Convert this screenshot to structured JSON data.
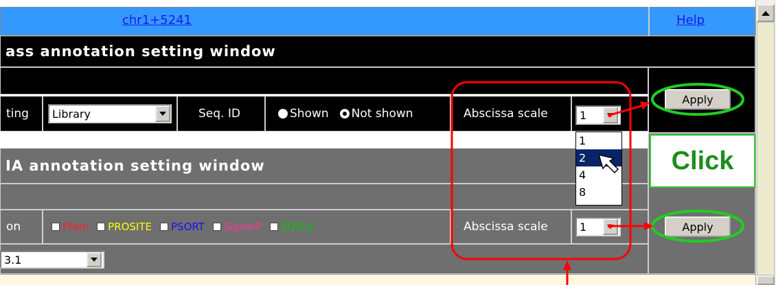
{
  "header": {
    "position_link": "chr1+5241",
    "help_link": "Help"
  },
  "section1": {
    "title": "ass annotation setting window",
    "setting_label": "ting",
    "library_select": "Library",
    "seq_id_label": "Seq. ID",
    "radio_shown": "Shown",
    "radio_not_shown": "Not shown",
    "abscissa_label": "Abscissa scale",
    "abscissa_value": "1",
    "apply_label": "Apply",
    "dropdown_options": [
      "1",
      "2",
      "4",
      "8"
    ],
    "dropdown_highlighted": "2"
  },
  "section2": {
    "title": "IA annotation setting window",
    "annotation_label": "on",
    "checkboxes": [
      {
        "label": "Pfam",
        "color": "#ff2020"
      },
      {
        "label": "PROSITE",
        "color": "#ffff00"
      },
      {
        "label": "PSORT",
        "color": "#1010ff"
      },
      {
        "label": "SignalP",
        "color": "#ff3399"
      },
      {
        "label": "SOSUI",
        "color": "#00cc00"
      }
    ],
    "abscissa_label": "Abscissa scale",
    "abscissa_value": "1",
    "apply_label": "Apply",
    "version_select": "3.1"
  },
  "callout": {
    "text": "Click"
  },
  "colors": {
    "highlight_red": "#ff0000",
    "highlight_green": "#22cc22",
    "select_blue": "#0a246a"
  }
}
